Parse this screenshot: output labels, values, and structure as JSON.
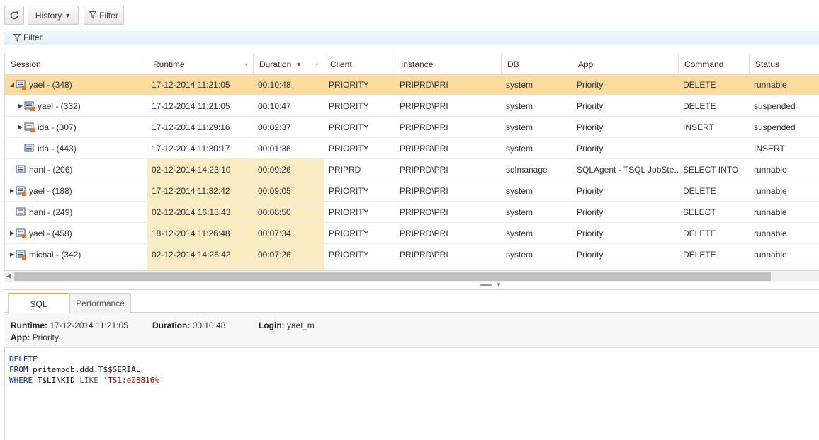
{
  "toolbar": {
    "refresh_icon": "refresh-icon",
    "history_label": "History",
    "filter_label": "Filter"
  },
  "filter_bar": {
    "label": "Filter"
  },
  "grid": {
    "columns": [
      {
        "label": "Session"
      },
      {
        "label": "Runtime"
      },
      {
        "label": "Duration"
      },
      {
        "label": "Client"
      },
      {
        "label": "Instance"
      },
      {
        "label": "DB"
      },
      {
        "label": "App"
      },
      {
        "label": "Command"
      },
      {
        "label": "Status"
      }
    ],
    "rows": [
      {
        "session": "yael - (348)",
        "runtime": "17-12-2014 11:21:05",
        "duration": "00:10:48",
        "client": "PRIORITY",
        "instance": "PRIPRD\\PRI",
        "db": "system",
        "app": "Priority",
        "command": "DELETE",
        "status": "runnable"
      },
      {
        "session": "yael - (332)",
        "runtime": "17-12-2014 11:21:05",
        "duration": "00:10:47",
        "client": "PRIORITY",
        "instance": "PRIPRD\\PRI",
        "db": "system",
        "app": "Priority",
        "command": "DELETE",
        "status": "suspended"
      },
      {
        "session": "ida - (307)",
        "runtime": "17-12-2014 11:29:16",
        "duration": "00:02:37",
        "client": "PRIORITY",
        "instance": "PRIPRD\\PRI",
        "db": "system",
        "app": "Priority",
        "command": "INSERT",
        "status": "suspended"
      },
      {
        "session": "ida - (443)",
        "runtime": "17-12-2014 11:30:17",
        "duration": "00:01:36",
        "client": "PRIORITY",
        "instance": "PRIPRD\\PRI",
        "db": "system",
        "app": "Priority",
        "command": "",
        "status": "INSERT"
      },
      {
        "session": "hani - (206)",
        "runtime": "02-12-2014 14:23:10",
        "duration": "00:09:26",
        "client": "PRIPRD",
        "instance": "PRIPRD\\PRI",
        "db": "sqlmanage",
        "app": "SQLAgent - TSQL JobSte...",
        "command": "SELECT INTO",
        "status": "runnable"
      },
      {
        "session": "yael - (188)",
        "runtime": "17-12-2014 11:32:42",
        "duration": "00:09:05",
        "client": "PRIORITY",
        "instance": "PRIPRD\\PRI",
        "db": "system",
        "app": "Priority",
        "command": "DELETE",
        "status": "runnable"
      },
      {
        "session": "hani - (249)",
        "runtime": "02-12-2014 16:13:43",
        "duration": "00:08:50",
        "client": "PRIORITY",
        "instance": "PRIPRD\\PRI",
        "db": "system",
        "app": "Priority",
        "command": "SELECT",
        "status": "runnable"
      },
      {
        "session": "yael - (458)",
        "runtime": "18-12-2014 11:26:48",
        "duration": "00:07:34",
        "client": "PRIORITY",
        "instance": "PRIPRD\\PRI",
        "db": "system",
        "app": "Priority",
        "command": "DELETE",
        "status": "runnable"
      },
      {
        "session": "michal - (342)",
        "runtime": "02-12-2014 14:26:42",
        "duration": "00:07:26",
        "client": "PRIORITY",
        "instance": "PRIPRD\\PRI",
        "db": "system",
        "app": "Priority",
        "command": "DELETE",
        "status": "runnable"
      }
    ]
  },
  "tabs": [
    {
      "label": "SQL"
    },
    {
      "label": "Performance"
    }
  ],
  "detail": {
    "runtime_label": "Runtime:",
    "runtime_value": "17-12-2014 11:21:05",
    "duration_label": "Duration:",
    "duration_value": "00:10:48",
    "login_label": "Login:",
    "login_value": "yael_m",
    "app_label": "App:",
    "app_value": "Priority"
  },
  "sql": {
    "line1_kw": "DELETE",
    "line2_kw": "FROM",
    "line2_rest": " pritempdb.ddd.T$$SERIAL",
    "line3_kw": "WHERE",
    "line3_mid": " T$LINKID ",
    "line3_op": "LIKE",
    "line3_str": " 'TS1:e08816%'"
  }
}
